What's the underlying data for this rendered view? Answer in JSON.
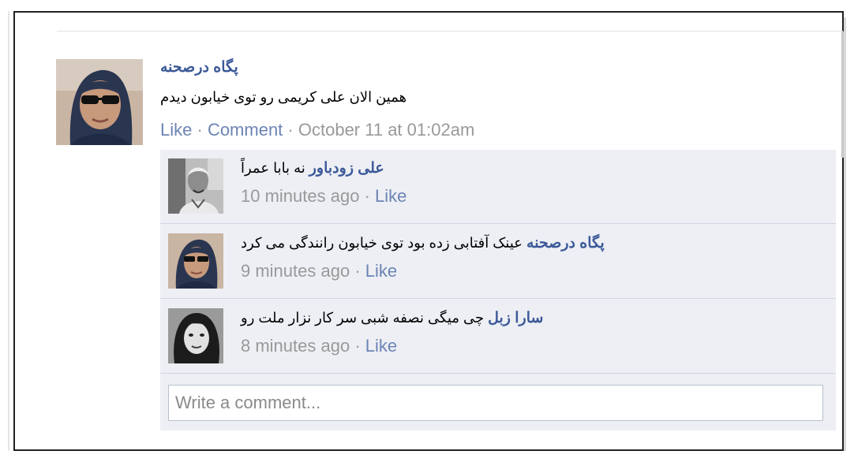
{
  "post": {
    "author": "پگاه درصحنه",
    "text": "همین الان علی کریمی رو توی خیابون دیدم",
    "like_label": "Like",
    "separator": "·",
    "comment_label": "Comment",
    "timestamp": "October 11 at 01:02am"
  },
  "comments": [
    {
      "name": "علی زودباور",
      "text": "نه بابا عمراً",
      "time": "10 minutes ago",
      "like_label": "Like"
    },
    {
      "name": "پگاه درصحنه",
      "text": "عینک آفتابی زده بود توی خیابون رانندگی می کرد",
      "time": "9 minutes ago",
      "like_label": "Like"
    },
    {
      "name": "سارا زبل",
      "text": "چی میگی نصفه شبی سر کار نزار ملت رو",
      "time": "8 minutes ago",
      "like_label": "Like"
    }
  ],
  "composer": {
    "placeholder": "Write a comment..."
  },
  "colors": {
    "link": "#3b5998",
    "link_light": "#6d84b4",
    "meta_gray": "#999999",
    "comment_bg": "#edeff4"
  }
}
